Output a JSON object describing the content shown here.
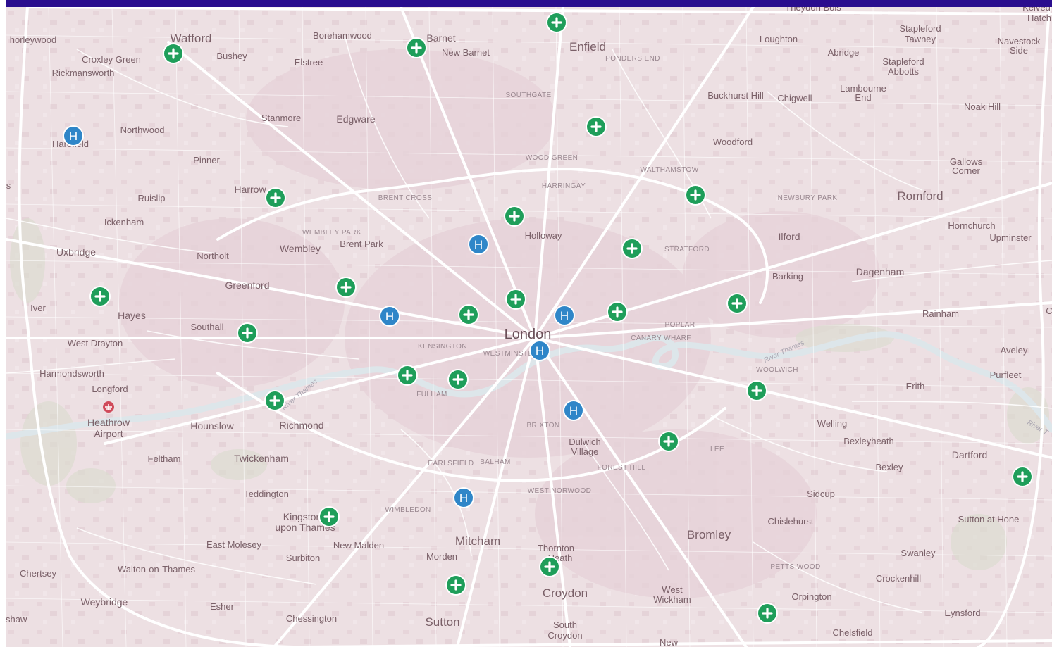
{
  "map": {
    "labels": {
      "watford": "Watford",
      "borehamwood": "Borehamwood",
      "barnet": "Barnet",
      "new_barnet": "New Barnet",
      "enfield": "Enfield",
      "ponders_end": "PONDERS END",
      "loughton": "Loughton",
      "stapleford_tawney_1": "Stapleford",
      "stapleford_tawney_2": "Tawney",
      "navestock_side_1": "Navestock",
      "navestock_side_2": "Side",
      "horleywood": "horleywood",
      "croxley_green": "Croxley Green",
      "bushey": "Bushey",
      "elstree": "Elstree",
      "abridge": "Abridge",
      "stapleford_abbotts_1": "Stapleford",
      "stapleford_abbotts_2": "Abbotts",
      "rickmansworth": "Rickmansworth",
      "southgate": "SOUTHGATE",
      "lambourne_end_1": "Lambourne",
      "lambourne_end_2": "End",
      "buckhurst_hill": "Buckhurst Hill",
      "chigwell": "Chigwell",
      "noak_hill": "Noak Hill",
      "stanmore": "Stanmore",
      "edgware": "Edgware",
      "northwood": "Northwood",
      "harefield": "Harefield",
      "woodford": "Woodford",
      "wood_green": "WOOD GREEN",
      "pinner": "Pinner",
      "walthamstow": "WALTHAMSTOW",
      "gallows_corner_1": "Gallows",
      "gallows_corner_2": "Corner",
      "harringay": "HARRINGAY",
      "harrow": "Harrow",
      "ruislip": "Ruislip",
      "brent_cross": "BRENT CROSS",
      "newbury_park": "NEWBURY PARK",
      "romford": "Romford",
      "ickenham": "Ickenham",
      "hornchurch": "Hornchurch",
      "wembley_park": "WEMBLEY PARK",
      "upminster": "Upminster",
      "holloway": "Holloway",
      "ilford": "Ilford",
      "brent_park": "Brent Park",
      "wembley": "Wembley",
      "uxbridge": "Uxbridge",
      "northolt": "Northolt",
      "stratford": "STRATFORD",
      "barking": "Barking",
      "dagenham": "Dagenham",
      "greenford": "Greenford",
      "iver": "Iver",
      "hayes": "Hayes",
      "rainham": "Rainham",
      "southall": "Southall",
      "poplar": "POPLAR",
      "london": "London",
      "canary_wharf": "CANARY WHARF",
      "kensington": "KENSINGTON",
      "west_drayton": "West Drayton",
      "westminster": "WESTMINSTER",
      "aveley": "Aveley",
      "river_thames_east": "River Thames",
      "woolwich": "WOOLWICH",
      "harmondsworth": "Harmondsworth",
      "purfleet": "Purfleet",
      "erith": "Erith",
      "longford": "Longford",
      "fulham": "FULHAM",
      "river_thames_west": "River Thames",
      "heathrow_1": "Heathrow",
      "heathrow_2": "Airport",
      "hounslow": "Hounslow",
      "richmond": "Richmond",
      "brixton": "BRIXTON",
      "welling": "Welling",
      "river_thames_far": "River T",
      "dulwich_1": "Dulwich",
      "dulwich_2": "Village",
      "bexleyheath": "Bexleyheath",
      "lee": "LEE",
      "dartford": "Dartford",
      "feltham": "Feltham",
      "twickenham": "Twickenham",
      "earlsfield": "EARLSFIELD",
      "balham": "BALHAM",
      "forest_hill": "FOREST HILL",
      "bexley": "Bexley",
      "teddington": "Teddington",
      "west_norwood": "WEST NORWOOD",
      "sidcup": "Sidcup",
      "wimbledon": "WIMBLEDON",
      "kingston_1": "Kingston",
      "kingston_2": "upon Thames",
      "chislehurst": "Chislehurst",
      "sutton_at_hone": "Sutton at Hone",
      "bromley": "Bromley",
      "mitcham": "Mitcham",
      "east_molesey": "East Molesey",
      "new_malden": "New Malden",
      "thornton_heath_1": "Thornton",
      "thornton_heath_2": "Heath",
      "swanley": "Swanley",
      "morden": "Morden",
      "surbiton": "Surbiton",
      "petts_wood": "PETTS WOOD",
      "walton": "Walton-on-Thames",
      "chertsey": "Chertsey",
      "crockenhill": "Crockenhill",
      "west_wickham_1": "West",
      "west_wickham_2": "Wickham",
      "croydon": "Croydon",
      "orpington": "Orpington",
      "weybridge": "Weybridge",
      "esher": "Esher",
      "eynsford": "Eynsford",
      "chessington": "Chessington",
      "sutton": "Sutton",
      "south_croydon_1": "South",
      "south_croydon_2": "Croydon",
      "chelsfield": "Chelsfield",
      "new_addington": "New",
      "shaw": "rshaw",
      "kelvedon_1": "Kelved",
      "kelvedon_2": "Hatch",
      "theydon": "Theydon Bois",
      "left_s": "s",
      "right_c": "C"
    },
    "hospital_letter": "H",
    "colors": {
      "land": "#ede0e3",
      "clinic_marker": "#1f9e5a",
      "hospital_marker": "#2f86c8",
      "header": "#2a0d8e"
    }
  }
}
